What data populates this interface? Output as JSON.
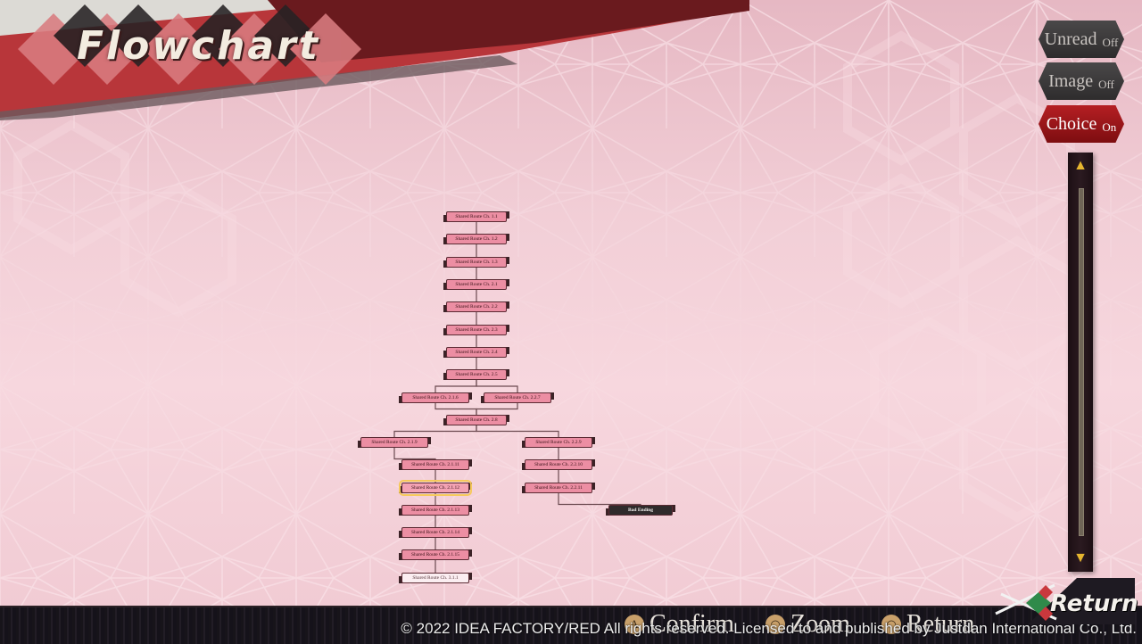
{
  "screen": {
    "title": "Flowchart"
  },
  "filters": [
    {
      "label": "Unread",
      "state": "Off",
      "active": false
    },
    {
      "label": "Image",
      "state": "Off",
      "active": false
    },
    {
      "label": "Choice",
      "state": "On",
      "active": true
    }
  ],
  "scrollbar": {
    "up_icon": "▲",
    "down_icon": "▼",
    "position": 0
  },
  "flowchart": {
    "nodes": [
      {
        "id": "n1",
        "label": "Shared Route Ch. 1.1",
        "status": "read"
      },
      {
        "id": "n2",
        "label": "Shared Route Ch. 1.2",
        "status": "read"
      },
      {
        "id": "n3",
        "label": "Shared Route Ch. 1.3",
        "status": "read"
      },
      {
        "id": "n4",
        "label": "Shared Route Ch. 2.1",
        "status": "read"
      },
      {
        "id": "n5",
        "label": "Shared Route Ch. 2.2",
        "status": "read"
      },
      {
        "id": "n6",
        "label": "Shared Route Ch. 2.3",
        "status": "read"
      },
      {
        "id": "n7",
        "label": "Shared Route Ch. 2.4",
        "status": "read"
      },
      {
        "id": "n8",
        "label": "Shared Route Ch. 2.5",
        "status": "read"
      },
      {
        "id": "n9",
        "label": "Shared Route Ch. 2.1.6",
        "status": "read"
      },
      {
        "id": "n10",
        "label": "Shared Route Ch. 2.2.7",
        "status": "read"
      },
      {
        "id": "n11",
        "label": "Shared Route Ch. 2.8",
        "status": "read"
      },
      {
        "id": "n12",
        "label": "Shared Route Ch. 2.1.9",
        "status": "read"
      },
      {
        "id": "n13",
        "label": "Shared Route Ch. 2.2.9",
        "status": "read"
      },
      {
        "id": "n14",
        "label": "Shared Route Ch. 2.1.11",
        "status": "read"
      },
      {
        "id": "n15",
        "label": "Shared Route Ch. 2.2.10",
        "status": "read"
      },
      {
        "id": "n16",
        "label": "Shared Route Ch. 2.1.12",
        "status": "selected"
      },
      {
        "id": "n17",
        "label": "Shared Route Ch. 2.2.11",
        "status": "read"
      },
      {
        "id": "n18",
        "label": "Bad Ending",
        "status": "ending"
      },
      {
        "id": "n19",
        "label": "Shared Route Ch. 2.1.13",
        "status": "read"
      },
      {
        "id": "n20",
        "label": "Shared Route Ch. 2.1.14",
        "status": "read"
      },
      {
        "id": "n21",
        "label": "Shared Route Ch. 2.1.15",
        "status": "read"
      },
      {
        "id": "n22",
        "label": "Shared Route Ch. 3.1.1",
        "status": "unread"
      }
    ],
    "edges": [
      [
        "n1",
        "n2"
      ],
      [
        "n2",
        "n3"
      ],
      [
        "n3",
        "n4"
      ],
      [
        "n4",
        "n5"
      ],
      [
        "n5",
        "n6"
      ],
      [
        "n6",
        "n7"
      ],
      [
        "n7",
        "n8"
      ],
      [
        "n8",
        "n9"
      ],
      [
        "n8",
        "n10"
      ],
      [
        "n9",
        "n11"
      ],
      [
        "n10",
        "n11"
      ],
      [
        "n11",
        "n12"
      ],
      [
        "n11",
        "n13"
      ],
      [
        "n12",
        "n14"
      ],
      [
        "n14",
        "n16"
      ],
      [
        "n16",
        "n19"
      ],
      [
        "n19",
        "n20"
      ],
      [
        "n20",
        "n21"
      ],
      [
        "n21",
        "n22"
      ],
      [
        "n13",
        "n15"
      ],
      [
        "n15",
        "n17"
      ],
      [
        "n17",
        "n18"
      ]
    ]
  },
  "footer": {
    "hints": [
      {
        "icon": "A",
        "label": "Confirm"
      },
      {
        "icon": "◠",
        "label": "Zoom"
      },
      {
        "icon": "◠",
        "label": "Return"
      }
    ],
    "copyright": "©  2022 IDEA FACTORY/RED All rights reserved. Licensed to and published by Justdan International Co., Ltd.",
    "return_label": "Return"
  },
  "colors": {
    "node_fill": "#ec8ea3",
    "node_selected_outline": "#f6c95c",
    "choice_on": "#b51f23",
    "toggle_off": "#3c3a3b",
    "banner_red": "#b8363a",
    "banner_dark": "#6a1a1e"
  }
}
